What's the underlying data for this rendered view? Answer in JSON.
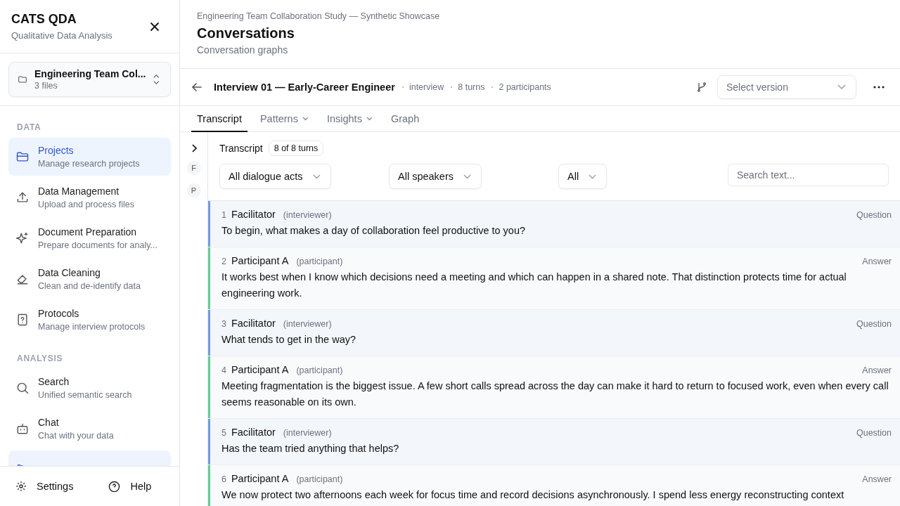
{
  "app": {
    "name": "CATS QDA",
    "subtitle": "Qualitative Data Analysis"
  },
  "project": {
    "name": "Engineering Team Col...",
    "files": "3 files"
  },
  "nav_sections": [
    {
      "label": "DATA",
      "items": [
        {
          "title": "Projects",
          "desc": "Manage research projects",
          "selected": true
        },
        {
          "title": "Data Management",
          "desc": "Upload and process files",
          "selected": false
        },
        {
          "title": "Document Preparation",
          "desc": "Prepare documents for analy...",
          "selected": false
        },
        {
          "title": "Data Cleaning",
          "desc": "Clean and de-identify data",
          "selected": false
        },
        {
          "title": "Protocols",
          "desc": "Manage interview protocols",
          "selected": false
        }
      ]
    },
    {
      "label": "ANALYSIS",
      "items": [
        {
          "title": "Search",
          "desc": "Unified semantic search",
          "selected": false
        },
        {
          "title": "Chat",
          "desc": "Chat with your data",
          "selected": false
        },
        {
          "selected": true
        }
      ]
    }
  ],
  "footer": [
    {
      "label": "Settings"
    },
    {
      "label": "Help"
    }
  ],
  "page": {
    "breadcrumb": "Engineering Team Collaboration Study — Synthetic Showcase",
    "title": "Conversations",
    "subtitle": "Conversation graphs"
  },
  "conversation": {
    "title": "Interview 01 — Early-Career Engineer",
    "meta": [
      "interview",
      "8 turns",
      "2 participants"
    ],
    "version_placeholder": "Select version"
  },
  "tabs": [
    {
      "label": "Transcript",
      "selected": true,
      "has_menu": false
    },
    {
      "label": "Patterns",
      "selected": false,
      "has_menu": true
    },
    {
      "label": "Insights",
      "selected": false,
      "has_menu": true
    },
    {
      "label": "Graph",
      "selected": false,
      "has_menu": false
    }
  ],
  "rail": [
    "F",
    "P"
  ],
  "transcript": {
    "title": "Transcript",
    "count": "8 of 8 turns",
    "filters": [
      "All dialogue acts",
      "All speakers",
      "All"
    ],
    "search_placeholder": "Search text...",
    "turns": [
      {
        "number": "1",
        "speaker": "Facilitator",
        "role": "(interviewer)",
        "act": "Question",
        "color": "#6f9ceb",
        "text": "To begin, what makes a day of collaboration feel productive to you?"
      },
      {
        "number": "2",
        "speaker": "Participant A",
        "role": "(participant)",
        "act": "Answer",
        "color": "#5fcf94",
        "text": "It works best when I know which decisions need a meeting and which can happen in a shared note. That distinction protects time for actual engineering work."
      },
      {
        "number": "3",
        "speaker": "Facilitator",
        "role": "(interviewer)",
        "act": "Question",
        "color": "#6f9ceb",
        "text": "What tends to get in the way?"
      },
      {
        "number": "4",
        "speaker": "Participant A",
        "role": "(participant)",
        "act": "Answer",
        "color": "#5fcf94",
        "text": "Meeting fragmentation is the biggest issue. A few short calls spread across the day can make it hard to return to focused work, even when every call seems reasonable on its own."
      },
      {
        "number": "5",
        "speaker": "Facilitator",
        "role": "(interviewer)",
        "act": "Question",
        "color": "#6f9ceb",
        "text": "Has the team tried anything that helps?"
      },
      {
        "number": "6",
        "speaker": "Participant A",
        "role": "(participant)",
        "act": "Answer",
        "color": "#5fcf94",
        "text": "We now protect two afternoons each week for focus time and record decisions asynchronously. I spend less energy reconstructing context"
      }
    ]
  }
}
